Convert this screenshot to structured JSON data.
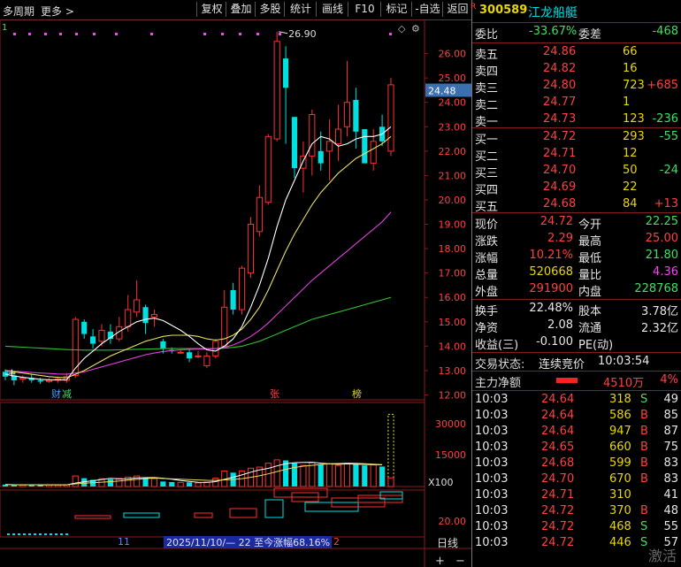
{
  "toolbar": {
    "period": "多周期",
    "more": "更多 >",
    "buttons": [
      "复权",
      "叠加",
      "多股",
      "统计",
      "画线",
      "F10",
      "标记",
      "-自选",
      "返回"
    ]
  },
  "chart": {
    "indicator_label": "1",
    "price_axis": [
      "26.00",
      "25.00",
      "24.00",
      "23.00",
      "22.00",
      "21.00",
      "20.00",
      "19.00",
      "18.00",
      "17.00",
      "16.00",
      "15.00",
      "14.00",
      "13.00",
      "12.00"
    ],
    "current_price_tag": "24.48",
    "high_marker": "26.90",
    "event_labels": [
      {
        "text": "财",
        "color": "#40a0ff"
      },
      {
        "text": "减",
        "color": "#40e060"
      },
      {
        "text": "张",
        "color": "#ff4040"
      },
      {
        "text": "榜",
        "color": "#e8d800"
      }
    ],
    "volume_axis": [
      "30000",
      "15000"
    ],
    "volume_unit": "X100",
    "lower_axis": "20.00",
    "footer_left": "11",
    "footer_range": "2025/11/10/— 22 至今涨幅68.16%",
    "footer_right": "2",
    "footer_tab": "日线"
  },
  "chart_data": {
    "type": "candlestick",
    "ylim": [
      11.8,
      27.4
    ],
    "candles": [
      {
        "o": 12.95,
        "c": 12.75,
        "h": 13.05,
        "l": 12.6
      },
      {
        "o": 12.8,
        "c": 12.6,
        "h": 12.9,
        "l": 12.4
      },
      {
        "o": 12.65,
        "c": 12.7,
        "h": 12.8,
        "l": 12.5
      },
      {
        "o": 12.7,
        "c": 12.6,
        "h": 12.85,
        "l": 12.5
      },
      {
        "o": 12.6,
        "c": 12.55,
        "h": 12.7,
        "l": 12.45
      },
      {
        "o": 12.55,
        "c": 12.6,
        "h": 12.7,
        "l": 12.5
      },
      {
        "o": 12.6,
        "c": 12.65,
        "h": 12.75,
        "l": 12.5
      },
      {
        "o": 12.6,
        "c": 12.75,
        "h": 12.9,
        "l": 12.5
      },
      {
        "o": 12.8,
        "c": 15.1,
        "h": 15.2,
        "l": 12.7
      },
      {
        "o": 15.0,
        "c": 14.5,
        "h": 15.1,
        "l": 14.3
      },
      {
        "o": 14.4,
        "c": 14.1,
        "h": 14.7,
        "l": 13.9
      },
      {
        "o": 14.2,
        "c": 14.65,
        "h": 14.9,
        "l": 14.0
      },
      {
        "o": 14.6,
        "c": 14.3,
        "h": 14.9,
        "l": 14.1
      },
      {
        "o": 14.3,
        "c": 14.8,
        "h": 15.2,
        "l": 14.2
      },
      {
        "o": 14.8,
        "c": 15.5,
        "h": 16.1,
        "l": 14.6
      },
      {
        "o": 15.4,
        "c": 15.9,
        "h": 16.7,
        "l": 15.2
      },
      {
        "o": 15.6,
        "c": 14.95,
        "h": 15.7,
        "l": 14.5
      },
      {
        "o": 15.2,
        "c": 15.3,
        "h": 15.5,
        "l": 14.8
      },
      {
        "o": 14.2,
        "c": 13.9,
        "h": 14.3,
        "l": 13.7
      },
      {
        "o": 13.85,
        "c": 13.8,
        "h": 13.95,
        "l": 13.7
      },
      {
        "o": 13.75,
        "c": 13.75,
        "h": 13.85,
        "l": 13.7
      },
      {
        "o": 13.75,
        "c": 13.5,
        "h": 13.85,
        "l": 13.35
      },
      {
        "o": 13.6,
        "c": 13.6,
        "h": 13.8,
        "l": 13.5
      },
      {
        "o": 13.2,
        "c": 13.6,
        "h": 13.75,
        "l": 13.1
      },
      {
        "o": 13.6,
        "c": 14.2,
        "h": 14.3,
        "l": 13.5
      },
      {
        "o": 14.0,
        "c": 15.6,
        "h": 16.3,
        "l": 13.9
      },
      {
        "o": 16.3,
        "c": 15.5,
        "h": 16.6,
        "l": 15.3
      },
      {
        "o": 15.5,
        "c": 17.2,
        "h": 17.3,
        "l": 15.3
      },
      {
        "o": 17.0,
        "c": 19.0,
        "h": 19.3,
        "l": 16.8
      },
      {
        "o": 18.7,
        "c": 20.1,
        "h": 20.6,
        "l": 18.5
      },
      {
        "o": 19.9,
        "c": 22.6,
        "h": 22.7,
        "l": 19.8
      },
      {
        "o": 22.5,
        "c": 26.5,
        "h": 26.9,
        "l": 22.4
      },
      {
        "o": 25.8,
        "c": 24.6,
        "h": 26.3,
        "l": 22.3
      },
      {
        "o": 23.4,
        "c": 21.3,
        "h": 23.4,
        "l": 20.9
      },
      {
        "o": 21.3,
        "c": 21.8,
        "h": 22.4,
        "l": 20.3
      },
      {
        "o": 21.8,
        "c": 23.5,
        "h": 23.7,
        "l": 21.0
      },
      {
        "o": 22.0,
        "c": 21.5,
        "h": 22.8,
        "l": 21.2
      },
      {
        "o": 22.0,
        "c": 22.4,
        "h": 23.3,
        "l": 20.8
      },
      {
        "o": 22.3,
        "c": 22.9,
        "h": 23.9,
        "l": 21.6
      },
      {
        "o": 23.0,
        "c": 24.0,
        "h": 25.7,
        "l": 22.6
      },
      {
        "o": 24.1,
        "c": 22.8,
        "h": 24.6,
        "l": 22.1
      },
      {
        "o": 22.9,
        "c": 21.5,
        "h": 22.9,
        "l": 21.5
      },
      {
        "o": 21.5,
        "c": 22.4,
        "h": 22.9,
        "l": 21.2
      },
      {
        "o": 23.0,
        "c": 22.4,
        "h": 23.5,
        "l": 22.2
      },
      {
        "o": 22.0,
        "c": 24.72,
        "h": 25.0,
        "l": 21.8
      }
    ],
    "ma_white": [
      12.85,
      12.78,
      12.72,
      12.68,
      12.64,
      12.62,
      12.62,
      12.62,
      13.1,
      13.5,
      13.8,
      14.1,
      14.35,
      14.6,
      14.8,
      15.0,
      15.1,
      15.15,
      15.05,
      14.85,
      14.65,
      14.4,
      14.1,
      13.85,
      13.8,
      14.0,
      14.3,
      14.8,
      15.6,
      16.5,
      17.6,
      18.9,
      20.0,
      20.8,
      21.6,
      22.3,
      22.6,
      22.5,
      22.2,
      22.3,
      22.5,
      22.6,
      22.6,
      22.7,
      23.0
    ],
    "ma_yellow": [
      13.0,
      12.95,
      12.9,
      12.85,
      12.8,
      12.75,
      12.72,
      12.7,
      12.85,
      13.0,
      13.2,
      13.4,
      13.6,
      13.75,
      13.9,
      14.05,
      14.2,
      14.3,
      14.4,
      14.45,
      14.45,
      14.45,
      14.4,
      14.3,
      14.25,
      14.3,
      14.45,
      14.7,
      15.1,
      15.6,
      16.3,
      17.1,
      17.9,
      18.6,
      19.2,
      19.8,
      20.3,
      20.7,
      21.1,
      21.4,
      21.7,
      21.9,
      22.1,
      22.3,
      22.6
    ],
    "ma_magenta": [
      13.0,
      12.98,
      12.95,
      12.92,
      12.9,
      12.88,
      12.86,
      12.85,
      12.9,
      12.95,
      13.05,
      13.15,
      13.25,
      13.35,
      13.45,
      13.55,
      13.65,
      13.72,
      13.78,
      13.82,
      13.85,
      13.87,
      13.88,
      13.88,
      13.9,
      13.95,
      14.05,
      14.2,
      14.4,
      14.65,
      14.95,
      15.3,
      15.65,
      16.0,
      16.35,
      16.7,
      17.0,
      17.3,
      17.6,
      17.9,
      18.2,
      18.5,
      18.8,
      19.1,
      19.5
    ],
    "ma_green": [
      14.0,
      13.98,
      13.96,
      13.94,
      13.92,
      13.9,
      13.88,
      13.86,
      13.85,
      13.84,
      13.84,
      13.84,
      13.84,
      13.85,
      13.86,
      13.87,
      13.88,
      13.89,
      13.9,
      13.9,
      13.9,
      13.9,
      13.9,
      13.9,
      13.9,
      13.92,
      13.95,
      14.0,
      14.1,
      14.2,
      14.35,
      14.5,
      14.65,
      14.8,
      14.95,
      15.1,
      15.2,
      15.3,
      15.4,
      15.5,
      15.6,
      15.7,
      15.8,
      15.9,
      16.0
    ],
    "volume": [
      35,
      30,
      28,
      32,
      30,
      31,
      29,
      30,
      190,
      150,
      120,
      140,
      130,
      145,
      170,
      190,
      160,
      140,
      90,
      80,
      70,
      75,
      65,
      80,
      150,
      280,
      250,
      280,
      330,
      350,
      420,
      480,
      470,
      420,
      380,
      430,
      400,
      410,
      380,
      420,
      400,
      380,
      390,
      360,
      1300
    ],
    "volume_ylim": [
      0,
      1450
    ]
  },
  "quote": {
    "code": "300589",
    "name": "江龙船艇",
    "weibi_label": "委比",
    "weibi": "-33.67%",
    "weicha_label": "委差",
    "weicha": "-468",
    "asks": [
      {
        "label": "卖五",
        "price": "24.86",
        "vol": "66",
        "chg": ""
      },
      {
        "label": "卖四",
        "price": "24.82",
        "vol": "16",
        "chg": ""
      },
      {
        "label": "卖三",
        "price": "24.80",
        "vol": "723",
        "chg": "+685"
      },
      {
        "label": "卖二",
        "price": "24.77",
        "vol": "1",
        "chg": ""
      },
      {
        "label": "卖一",
        "price": "24.73",
        "vol": "123",
        "chg": "-236"
      }
    ],
    "bids": [
      {
        "label": "买一",
        "price": "24.72",
        "vol": "293",
        "chg": "-55"
      },
      {
        "label": "买二",
        "price": "24.71",
        "vol": "12",
        "chg": ""
      },
      {
        "label": "买三",
        "price": "24.70",
        "vol": "50",
        "chg": "-24"
      },
      {
        "label": "买四",
        "price": "24.69",
        "vol": "22",
        "chg": ""
      },
      {
        "label": "买五",
        "price": "24.68",
        "vol": "84",
        "chg": "+13"
      }
    ],
    "stats": [
      {
        "l1": "现价",
        "v1": "24.72",
        "c1": "red",
        "l2": "今开",
        "v2": "22.25",
        "c2": "green"
      },
      {
        "l1": "涨跌",
        "v1": "2.29",
        "c1": "red",
        "l2": "最高",
        "v2": "25.00",
        "c2": "red"
      },
      {
        "l1": "涨幅",
        "v1": "10.21%",
        "c1": "red",
        "l2": "最低",
        "v2": "21.80",
        "c2": "green"
      },
      {
        "l1": "总量",
        "v1": "520668",
        "c1": "yel",
        "l2": "量比",
        "v2": "4.36",
        "c2": "mag"
      },
      {
        "l1": "外盘",
        "v1": "291900",
        "c1": "red",
        "l2": "内盘",
        "v2": "228768",
        "c2": "green"
      }
    ],
    "fundamentals": [
      {
        "l1": "换手",
        "v1": "22.48%",
        "l2": "股本",
        "v2": "3.78亿"
      },
      {
        "l1": "净资",
        "v1": "2.08",
        "l2": "流通",
        "v2": "2.32亿"
      },
      {
        "l1": "收益(三)",
        "v1": "-0.100",
        "l2": "PE(动)",
        "v2": ""
      }
    ],
    "trade_status_label": "交易状态:",
    "trade_status": "连续竞价",
    "trade_time": "10:03:54",
    "main_flow_label": "主力净额",
    "main_flow": "4510万",
    "main_flow_pct": "4%",
    "ticks": [
      {
        "t": "10:03",
        "p": "24.64",
        "v": "318",
        "bs": "S",
        "n": "49"
      },
      {
        "t": "10:03",
        "p": "24.64",
        "v": "586",
        "bs": "B",
        "n": "85"
      },
      {
        "t": "10:03",
        "p": "24.64",
        "v": "947",
        "bs": "B",
        "n": "87"
      },
      {
        "t": "10:03",
        "p": "24.65",
        "v": "660",
        "bs": "B",
        "n": "75"
      },
      {
        "t": "10:03",
        "p": "24.68",
        "v": "599",
        "bs": "B",
        "n": "83"
      },
      {
        "t": "10:03",
        "p": "24.70",
        "v": "670",
        "bs": "B",
        "n": "83"
      },
      {
        "t": "10:03",
        "p": "24.71",
        "v": "310",
        "bs": "",
        "n": "41"
      },
      {
        "t": "10:03",
        "p": "24.72",
        "v": "370",
        "bs": "B",
        "n": "48"
      },
      {
        "t": "10:03",
        "p": "24.72",
        "v": "468",
        "bs": "S",
        "n": "55"
      },
      {
        "t": "10:03",
        "p": "24.72",
        "v": "446",
        "bs": "S",
        "n": "57"
      }
    ],
    "watermark": "激活"
  }
}
